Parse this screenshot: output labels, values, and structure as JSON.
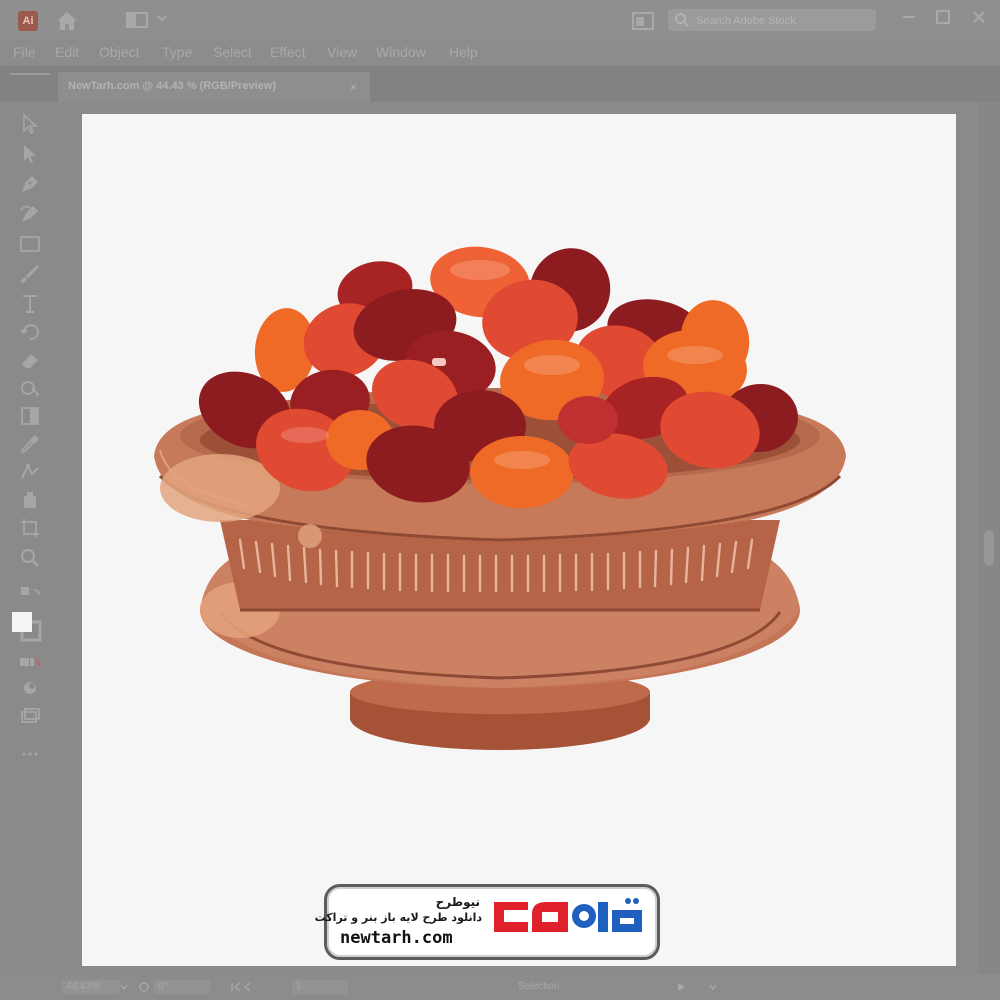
{
  "app": {
    "logo_text": "Ai"
  },
  "search": {
    "placeholder": "Search Adobe Stock"
  },
  "menu": {
    "items": [
      "File",
      "Edit",
      "Object",
      "Type",
      "Select",
      "Effect",
      "View",
      "Window",
      "Help"
    ]
  },
  "document_tab": {
    "label": "NewTarh.com @ 44.43 % (RGB/Preview)",
    "close_glyph": "×"
  },
  "toolbar": {
    "tools": [
      "selection-tool-icon",
      "direct-selection-tool-icon",
      "pen-tool-icon",
      "curvature-tool-icon",
      "rectangle-tool-icon",
      "paintbrush-tool-icon",
      "type-tool-icon",
      "rotate-tool-icon",
      "eraser-tool-icon",
      "shape-builder-tool-icon",
      "gradient-tool-icon",
      "eyedropper-tool-icon",
      "blend-tool-icon",
      "symbol-sprayer-tool-icon",
      "artboard-tool-icon",
      "zoom-tool-icon",
      "fill-stroke-swap-icon",
      "fill-stroke-swatch-icon",
      "color-mode-icon",
      "draw-mode-icon",
      "screen-mode-icon",
      "more-tools-icon"
    ]
  },
  "watermark": {
    "title": "نیوطرح",
    "subtitle": "دانلود طرح لایه باز بنر و تراکت",
    "url": "newtarh.com",
    "logo_text": "نیوطرح",
    "logo_colors": {
      "blue": "#1f5fbf",
      "red": "#e0202a"
    }
  },
  "statusbar": {
    "zoom": "44.43%",
    "rotation": "0°",
    "artboard_number": "1",
    "tool_name": "Selection"
  },
  "colors": {
    "ui_gray": "#8a8a8a",
    "artboard": "#f6f6f7",
    "bowl_main": "#c98163",
    "bowl_dark": "#8e4a34",
    "date_dark_red": "#8c1c1f",
    "date_red": "#e14a32",
    "date_orange": "#ef6a26"
  }
}
